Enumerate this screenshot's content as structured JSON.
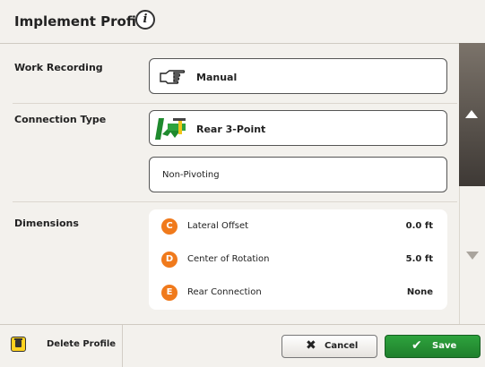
{
  "header": {
    "title": "Implement Profile",
    "info_icon": "info-icon"
  },
  "sections": {
    "work_recording": {
      "label": "Work Recording",
      "value": "Manual",
      "icon": "hand-pointer-icon"
    },
    "connection_type": {
      "label": "Connection Type",
      "value": "Rear 3-Point",
      "icon": "tractor-3-point-icon",
      "sub_value": "Non-Pivoting"
    },
    "dimensions": {
      "label": "Dimensions",
      "rows": [
        {
          "badge": "C",
          "label": "Lateral Offset",
          "value": "0.0 ft"
        },
        {
          "badge": "D",
          "label": "Center of Rotation",
          "value": "5.0 ft"
        },
        {
          "badge": "E",
          "label": "Rear Connection",
          "value": "None"
        }
      ]
    }
  },
  "scrollbar": {
    "up_icon": "arrow-up-icon",
    "down_icon": "arrow-down-icon"
  },
  "footer": {
    "delete_label": "Delete Profile",
    "delete_icon": "trash-icon",
    "cancel_label": "Cancel",
    "cancel_icon": "x-icon",
    "save_label": "Save",
    "save_icon": "checkmark-icon"
  },
  "colors": {
    "accent_green": "#2ea33d",
    "badge_orange": "#f07a1c",
    "delete_yellow": "#ffd21f",
    "scroll_dark": "#4a443f"
  }
}
